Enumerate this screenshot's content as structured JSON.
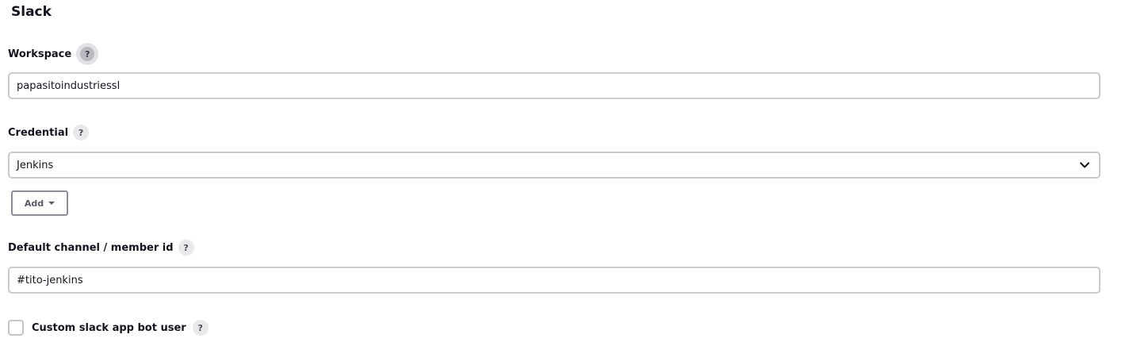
{
  "section": {
    "title": "Slack"
  },
  "workspace": {
    "label": "Workspace",
    "help": "?",
    "value": "papasitoindustriessl"
  },
  "credential": {
    "label": "Credential",
    "help": "?",
    "selected": "Jenkins",
    "add_label": "Add"
  },
  "default_channel": {
    "label": "Default channel / member id",
    "help": "?",
    "value": "#tito-jenkins"
  },
  "custom_bot": {
    "label": "Custom slack app bot user",
    "help": "?",
    "checked": false
  }
}
